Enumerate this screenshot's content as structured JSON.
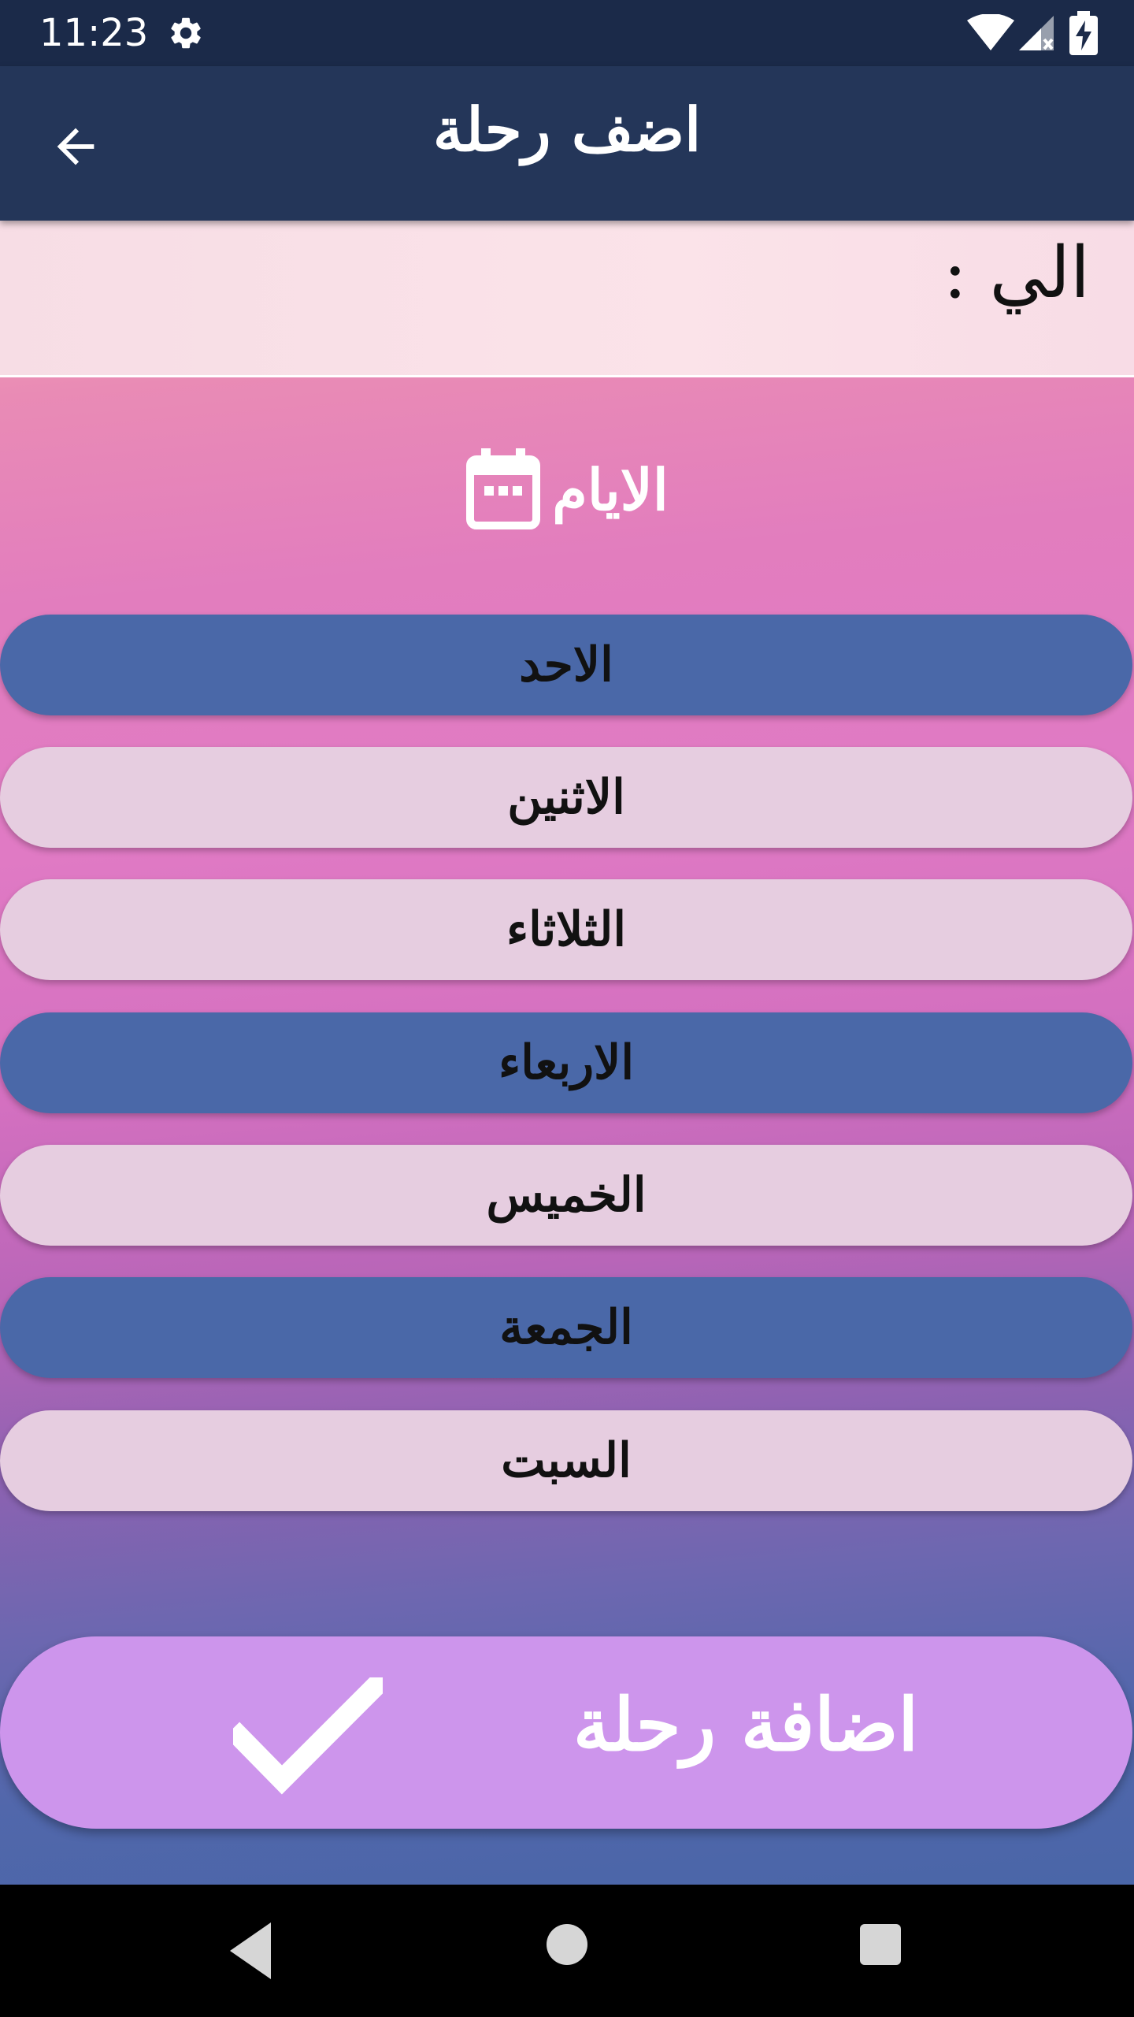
{
  "status_bar": {
    "time": "11:23"
  },
  "app_bar": {
    "title": "اضف رحلة"
  },
  "destination": {
    "label": "الي :"
  },
  "days_section": {
    "title": "الايام"
  },
  "days": [
    {
      "label": "الاحد",
      "selected": true
    },
    {
      "label": "الاثنين",
      "selected": false
    },
    {
      "label": "الثلاثاء",
      "selected": false
    },
    {
      "label": "الاربعاء",
      "selected": true
    },
    {
      "label": "الخميس",
      "selected": false
    },
    {
      "label": "الجمعة",
      "selected": true
    },
    {
      "label": "السبت",
      "selected": false
    }
  ],
  "add_button": {
    "label": "اضافة رحلة"
  },
  "colors": {
    "app_bar": "#243659",
    "selected_day": "#4a68a8",
    "unselected_day": "#e6cde0",
    "add_button": "#cd95ec"
  },
  "icons": {
    "back": "arrow-left-icon",
    "calendar": "calendar-icon",
    "check": "check-icon",
    "settings": "gear-icon",
    "wifi": "wifi-icon",
    "signal": "signal-icon",
    "battery": "battery-charging-icon"
  }
}
